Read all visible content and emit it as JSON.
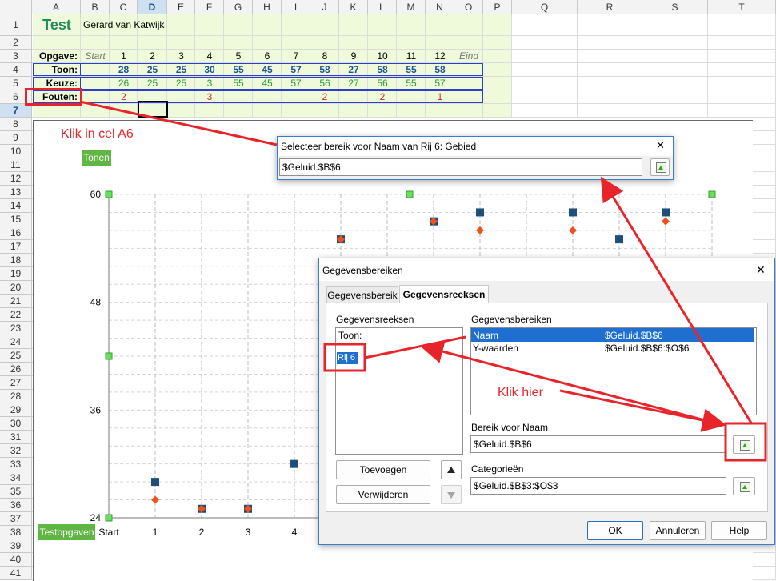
{
  "sheet": {
    "columns": [
      "A",
      "B",
      "C",
      "D",
      "E",
      "F",
      "G",
      "H",
      "I",
      "J",
      "K",
      "L",
      "M",
      "N",
      "O",
      "P",
      "Q",
      "R",
      "S",
      "T"
    ],
    "selected_column": "D",
    "rows": [
      "1",
      "2",
      "3",
      "4",
      "5",
      "6",
      "7",
      "8",
      "9",
      "10",
      "11",
      "12",
      "13",
      "14",
      "15",
      "16",
      "17",
      "18",
      "19",
      "20",
      "21",
      "22",
      "23",
      "24",
      "25",
      "26",
      "27",
      "28",
      "29",
      "30",
      "31",
      "32",
      "33",
      "34",
      "35",
      "36",
      "37",
      "38",
      "39",
      "40",
      "41"
    ],
    "selected_row": "7",
    "title": "Test",
    "author": "Gerard van Katwijk",
    "opgave_label": "Opgave:",
    "opgave_start": "Start",
    "opgave_values": [
      "1",
      "2",
      "3",
      "4",
      "5",
      "6",
      "7",
      "8",
      "9",
      "10",
      "11",
      "12"
    ],
    "opgave_end": "Eind",
    "toon_label": "Toon:",
    "toon_values": [
      "28",
      "25",
      "25",
      "30",
      "55",
      "45",
      "57",
      "58",
      "27",
      "58",
      "55",
      "58"
    ],
    "keuze_label": "Keuze:",
    "keuze_values": [
      "26",
      "25",
      "25",
      "3",
      "55",
      "45",
      "57",
      "56",
      "27",
      "56",
      "55",
      "57"
    ],
    "fouten_label": "Fouten:",
    "fouten_values": [
      "2",
      "",
      "",
      "3",
      "",
      "",
      "",
      "2",
      "",
      "2",
      "",
      "1"
    ]
  },
  "chart": {
    "tonen_label": "Tonen",
    "testopgaven_label": "Testopgaven",
    "chart_data": {
      "type": "scatter",
      "categories": [
        "Start",
        "1",
        "2",
        "3",
        "4"
      ],
      "y_ticks": [
        "60",
        "48",
        "36",
        "24"
      ],
      "ylim": [
        24,
        60
      ],
      "series": [
        {
          "name": "Toon:",
          "color": "#1f4e79",
          "marker": "square",
          "x": [
            1,
            2,
            3,
            4,
            5,
            6,
            7,
            8,
            9,
            10,
            11,
            12
          ],
          "y": [
            28,
            25,
            25,
            30,
            55,
            45,
            57,
            58,
            27,
            58,
            55,
            58
          ]
        },
        {
          "name": "Keuze:",
          "color": "#f0501e",
          "marker": "diamond",
          "x": [
            1,
            2,
            3,
            5,
            6,
            7,
            8,
            10,
            12
          ],
          "y": [
            26,
            25,
            25,
            55,
            45,
            57,
            56,
            56,
            57
          ]
        }
      ]
    }
  },
  "range_dialog": {
    "title": "Selecteer bereik voor Naam van Rij 6: Gebied",
    "value": "$Geluid.$B$6",
    "close_glyph": "✕"
  },
  "main_dialog": {
    "title": "Gegevensbereiken",
    "close_glyph": "✕",
    "tabs": [
      "Gegevensbereik",
      "Gegevensreeksen"
    ],
    "active_tab": "Gegevensreeksen",
    "series_label": "Gegevensreeksen",
    "series_items": [
      "Toon:",
      "Rij 6"
    ],
    "ranges_label": "Gegevensbereiken",
    "ranges": [
      {
        "name": "Naam",
        "value": "$Geluid.$B$6"
      },
      {
        "name": "Y-waarden",
        "value": "$Geluid.$B$6:$O$6"
      }
    ],
    "range_for_name_label": "Bereik voor Naam",
    "range_for_name_value": "$Geluid.$B$6",
    "categories_label": "Categorieën",
    "categories_value": "$Geluid.$B$3:$O$3",
    "add_button": "Toevoegen",
    "remove_button": "Verwijderen",
    "ok_button": "OK",
    "cancel_button": "Annuleren",
    "help_button": "Help"
  },
  "annotations": {
    "click_a6": "Klik in cel A6",
    "click_here": "Klik hier",
    "color": "#e8242b"
  }
}
